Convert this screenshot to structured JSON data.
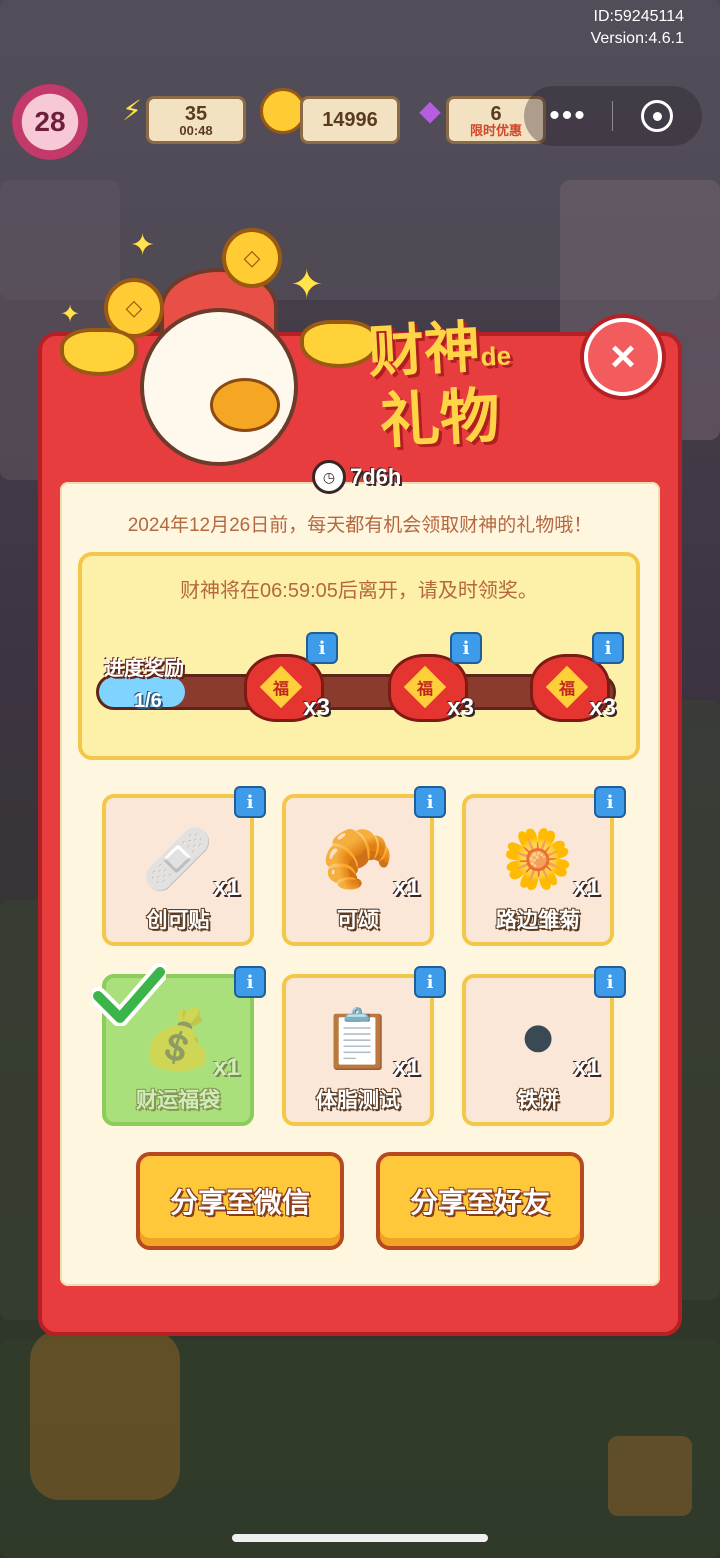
{
  "version": {
    "id": "ID:59245114",
    "version": "Version:4.6.1"
  },
  "topbar": {
    "level": "28",
    "energy": {
      "value": "35",
      "timer": "00:48"
    },
    "coins": {
      "value": "14996"
    },
    "gems": {
      "value": "6",
      "sub": "限时优惠"
    }
  },
  "capsule": {
    "more": "•••"
  },
  "modal": {
    "title_line1": "财神",
    "title_de": "de",
    "title_line2": "礼物",
    "close": "×",
    "timer": "7d6h",
    "description": "2024年12月26日前，每天都有机会领取财神的礼物哦！",
    "leave_notice": "财神将在06:59:05后离开，请及时领奖。",
    "progress": {
      "label": "进度奖励",
      "value_text": "1/6",
      "fraction": 0.1667,
      "rewards": [
        {
          "icon": "lucky-bag",
          "glyph": "福",
          "qty": "x3"
        },
        {
          "icon": "lucky-bag",
          "glyph": "福",
          "qty": "x3"
        },
        {
          "icon": "lucky-bag",
          "glyph": "福",
          "qty": "x3"
        }
      ]
    },
    "items": [
      {
        "name": "创可贴",
        "qty": "x1",
        "icon": "bandage-box-icon",
        "glyph": "🩹",
        "claimed": false
      },
      {
        "name": "可颂",
        "qty": "x1",
        "icon": "croissant-icon",
        "glyph": "🥐",
        "claimed": false
      },
      {
        "name": "路边雏菊",
        "qty": "x1",
        "icon": "daisy-icon",
        "glyph": "🌼",
        "claimed": false
      },
      {
        "name": "财运福袋",
        "qty": "x1",
        "icon": "fortune-bag-icon",
        "glyph": "💰",
        "claimed": true
      },
      {
        "name": "体脂测试",
        "qty": "x1",
        "icon": "clipboard-icon",
        "glyph": "📋",
        "claimed": false
      },
      {
        "name": "铁饼",
        "qty": "x1",
        "icon": "weight-plate-icon",
        "glyph": "⚫",
        "claimed": false
      }
    ],
    "info_glyph": "i",
    "buttons": {
      "share_wechat": "分享至微信",
      "share_friend": "分享至好友"
    }
  }
}
